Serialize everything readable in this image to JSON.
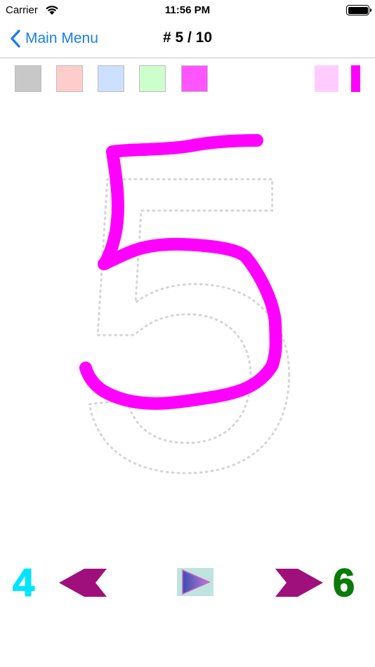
{
  "status_bar": {
    "carrier": "Carrier",
    "time": "11:56 PM",
    "wifi_icon": "wifi-icon",
    "battery_icon": "battery-icon"
  },
  "nav": {
    "back_label": "Main Menu",
    "back_icon": "chevron-left-icon",
    "title": "# 5 / 10"
  },
  "palette": {
    "swatches": [
      {
        "name": "gray",
        "color": "#c8c8c8"
      },
      {
        "name": "pink",
        "color": "#ffcccc"
      },
      {
        "name": "blue",
        "color": "#cce0ff"
      },
      {
        "name": "green",
        "color": "#ccffcc"
      },
      {
        "name": "magenta",
        "color": "#ff55ff"
      }
    ],
    "selected_color": "#ff00ff",
    "brush_preview_color": "#ffccff"
  },
  "canvas": {
    "guide_digit": "5",
    "guide_color": "#d6d6d6",
    "stroke_color": "#ff00ff"
  },
  "footer": {
    "prev_number": "4",
    "next_number": "6",
    "prev_number_color": "#00e5ff",
    "next_number_color": "#0a7a0a",
    "arrow_color": "#a0107c",
    "prev_icon": "arrow-left-icon",
    "next_icon": "arrow-right-icon",
    "play_icon": "play-icon"
  }
}
